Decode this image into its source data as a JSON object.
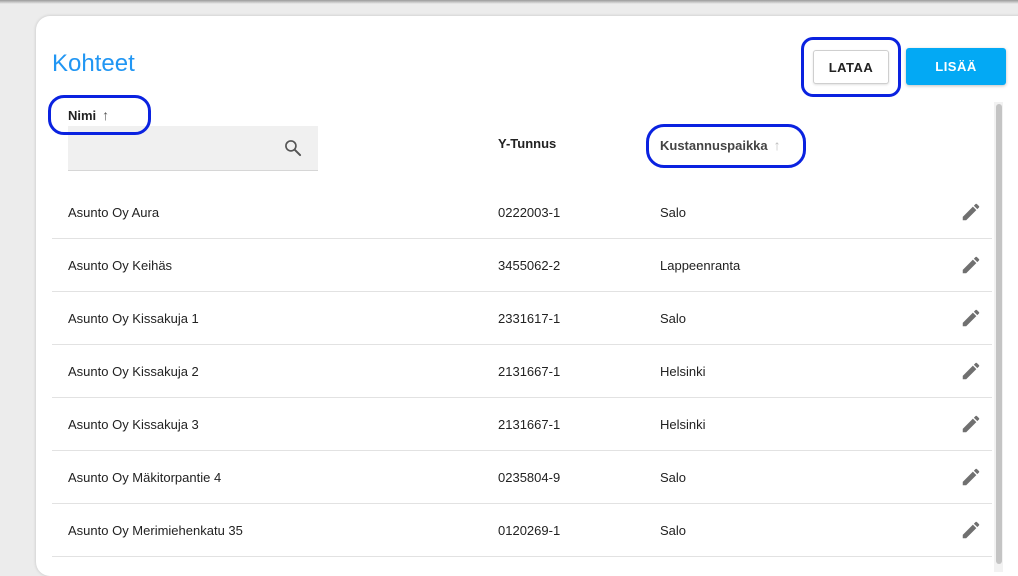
{
  "page": {
    "title": "Kohteet",
    "buttons": {
      "download": "LATAA",
      "add": "LISÄÄ"
    }
  },
  "colors": {
    "title": "#2196f3",
    "add_button": "#03a9f4",
    "highlight_ring": "#0a22e0"
  },
  "table": {
    "columns": {
      "name": "Nimi",
      "business_id": "Y-Tunnus",
      "cost_center": "Kustannuspaikka"
    },
    "sort_icons": {
      "name": "arrow-up-icon",
      "cost_center": "arrow-up-icon"
    },
    "search": {
      "placeholder": "",
      "value": ""
    },
    "rows": [
      {
        "name": "Asunto Oy Aura",
        "business_id": "0222003-1",
        "cost_center": "Salo"
      },
      {
        "name": "Asunto Oy Keihäs",
        "business_id": "3455062-2",
        "cost_center": "Lappeenranta"
      },
      {
        "name": "Asunto Oy Kissakuja 1",
        "business_id": "2331617-1",
        "cost_center": "Salo"
      },
      {
        "name": "Asunto Oy Kissakuja 2",
        "business_id": "2131667-1",
        "cost_center": "Helsinki"
      },
      {
        "name": "Asunto Oy Kissakuja 3",
        "business_id": "2131667-1",
        "cost_center": "Helsinki"
      },
      {
        "name": "Asunto Oy Mäkitorpantie 4",
        "business_id": "0235804-9",
        "cost_center": "Salo"
      },
      {
        "name": "Asunto Oy Merimiehenkatu 35",
        "business_id": "0120269-1",
        "cost_center": "Salo"
      }
    ],
    "row_action_icon": "pencil-icon"
  }
}
